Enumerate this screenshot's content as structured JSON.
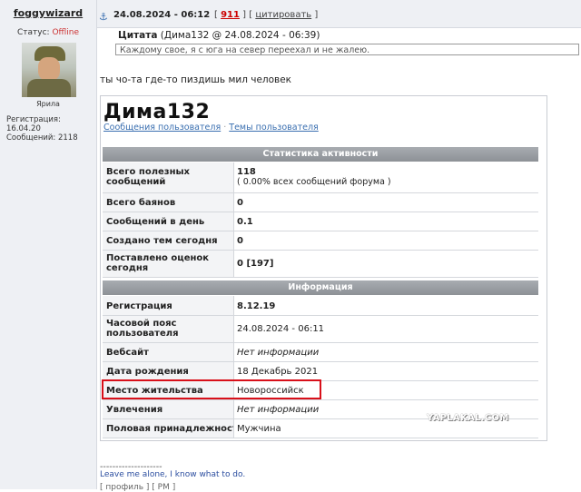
{
  "user": {
    "name": "foggywizard",
    "status_label": "Статус:",
    "status_value": "Offline",
    "avatar_caption": "Ярила",
    "reg_line": "Регистрация: 16.04.20",
    "posts_line": "Сообщений: 2118"
  },
  "post": {
    "anchor_icon": "⚓",
    "date": "24.08.2024 - 06:12",
    "bracket_open": "[",
    "post_number": "911",
    "bracket_mid": "] [",
    "quote_link": "цитировать",
    "bracket_close": "]",
    "quote_title_bold": "Цитата",
    "quote_title_rest": "(Дима132 @ 24.08.2024 - 06:39)",
    "quote_text": "Каждому свое, я с юга на север переехал и не жалею.",
    "message": "ты чо-та где-то пиздишь мил человек"
  },
  "profile": {
    "name": "Дима132",
    "link_posts": "Сообщения пользователя",
    "link_sep": "·",
    "link_topics": "Темы пользователя",
    "activity_header": "Статистика активности",
    "activity_rows": [
      {
        "key_1": "Всего полезных",
        "key_2": "сообщений",
        "value": "118",
        "value_sub": "( 0.00% всех сообщений форума )"
      },
      {
        "key_1": "Всего баянов",
        "value": "0"
      },
      {
        "key_1": "Сообщений в день",
        "value": "0.1"
      },
      {
        "key_1": "Создано тем сегодня",
        "value": "0"
      },
      {
        "key_1": "Поставлено оценок",
        "key_2": "сегодня",
        "value": "0 [197]"
      }
    ],
    "info_header": "Информация",
    "info_rows": [
      {
        "key_1": "Регистрация",
        "value": "8.12.19"
      },
      {
        "key_1": "Часовой пояс",
        "key_2": "пользователя",
        "value": "24.08.2024 - 06:11"
      },
      {
        "key_1": "Вебсайт",
        "value": "Нет информации"
      },
      {
        "key_1": "Дата рождения",
        "value": "18 Декабрь 2021"
      },
      {
        "key_1": "Место жительства",
        "value": "Новороссийск"
      },
      {
        "key_1": "Увлечения",
        "value": "Нет информации"
      },
      {
        "key_1": "Половая принадлежность",
        "value": "Мужчина"
      }
    ],
    "watermark": "YAPLAKAL.COM"
  },
  "signature": {
    "line": "--------------------",
    "text": "Leave me alone, I know what to do.",
    "footer": "[ профиль ] [ PM ]"
  },
  "colors": {
    "accent_link": "#3a6fb0",
    "offline": "#c33",
    "post_number": "#c00",
    "highlight_box": "#d8101a"
  }
}
